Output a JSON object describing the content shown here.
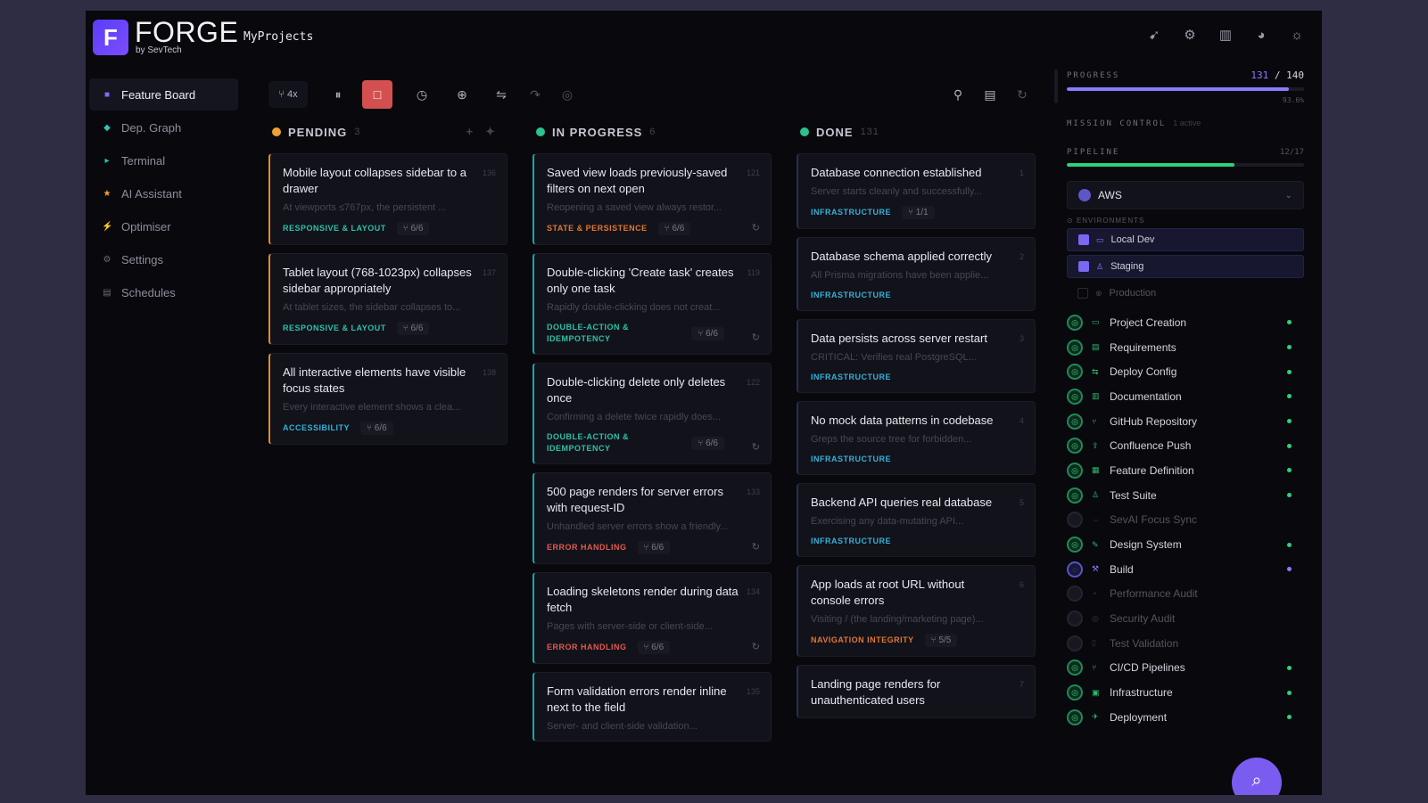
{
  "header": {
    "logo_letter": "F",
    "brand": "FORGE",
    "brand_sub": "by SevTech",
    "project": "MyProjects",
    "icons": [
      "rocket-icon",
      "gear-icon",
      "book-icon",
      "palette-icon",
      "sun-icon"
    ]
  },
  "sidebar": {
    "items": [
      {
        "label": "Feature Board",
        "icon": "■",
        "color": "#7c6cff"
      },
      {
        "label": "Dep. Graph",
        "icon": "◆",
        "color": "#2ec4b6"
      },
      {
        "label": "Terminal",
        "icon": "▸",
        "color": "#2ec4b6"
      },
      {
        "label": "AI Assistant",
        "icon": "★",
        "color": "#f0a030"
      },
      {
        "label": "Optimiser",
        "icon": "⚡",
        "color": "#22a6d8"
      },
      {
        "label": "Settings",
        "icon": "⚙",
        "color": "#6a6a78"
      },
      {
        "label": "Schedules",
        "icon": "▤",
        "color": "#6a6a78"
      }
    ]
  },
  "toolbar": {
    "concurrency": "⑂ 4x",
    "pause": "⏸",
    "stop": "□",
    "clock": "◷",
    "globe": "⊕",
    "sliders": "⇋",
    "dim1": "↷",
    "dim2": "◎",
    "right1": "⚲",
    "right2": "▤",
    "right3": "↻"
  },
  "columns": {
    "pending": {
      "title": "PENDING",
      "count": "3",
      "color": "#f0a030",
      "cards": [
        {
          "title": "Mobile layout collapses sidebar to a drawer",
          "id": "136",
          "desc": "At viewports ≤767px, the persistent ...",
          "tag": "RESPONSIVE & LAYOUT",
          "tag_class": "green",
          "count": "⑂ 6/6"
        },
        {
          "title": "Tablet layout (768-1023px) collapses sidebar appropriately",
          "id": "137",
          "desc": "At tablet sizes, the sidebar collapses to...",
          "tag": "RESPONSIVE & LAYOUT",
          "tag_class": "green",
          "count": "⑂ 6/6"
        },
        {
          "title": "All interactive elements have visible focus states",
          "id": "138",
          "desc": "Every interactive element shows a clea...",
          "tag": "ACCESSIBILITY",
          "tag_class": "blue",
          "count": "⑂ 6/6"
        }
      ]
    },
    "inprogress": {
      "title": "IN PROGRESS",
      "count": "6",
      "color": "#2cc28e",
      "cards": [
        {
          "title": "Saved view loads previously-saved filters on next open",
          "id": "121",
          "desc": "Reopening a saved view always restor...",
          "tag": "STATE & PERSISTENCE",
          "tag_class": "orange",
          "count": "⑂ 6/6"
        },
        {
          "title": "Double-clicking 'Create task' creates only one task",
          "id": "119",
          "desc": "Rapidly double-clicking does not creat...",
          "tag": "DOUBLE-ACTION & IDEMPOTENCY",
          "tag_class": "green",
          "count": "⑂ 6/6"
        },
        {
          "title": "Double-clicking delete only deletes once",
          "id": "122",
          "desc": "Confirming a delete twice rapidly does...",
          "tag": "DOUBLE-ACTION & IDEMPOTENCY",
          "tag_class": "green",
          "count": "⑂ 6/6"
        },
        {
          "title": "500 page renders for server errors with request-ID",
          "id": "133",
          "desc": "Unhandled server errors show a friendly...",
          "tag": "ERROR HANDLING",
          "tag_class": "red",
          "count": "⑂ 6/6"
        },
        {
          "title": "Loading skeletons render during data fetch",
          "id": "134",
          "desc": "Pages with server-side or client-side...",
          "tag": "ERROR HANDLING",
          "tag_class": "red",
          "count": "⑂ 6/6"
        },
        {
          "title": "Form validation errors render inline next to the field",
          "id": "135",
          "desc": "Server- and client-side validation...",
          "tag": "",
          "tag_class": "green",
          "count": ""
        }
      ]
    },
    "done": {
      "title": "DONE",
      "count": "131",
      "color": "#2cc28e",
      "cards": [
        {
          "title": "Database connection established",
          "id": "1",
          "desc": "Server starts cleanly and successfully...",
          "tag": "INFRASTRUCTURE",
          "tag_class": "blue",
          "count": "⑂ 1/1"
        },
        {
          "title": "Database schema applied correctly",
          "id": "2",
          "desc": "All Prisma migrations have been applie...",
          "tag": "INFRASTRUCTURE",
          "tag_class": "blue",
          "count": ""
        },
        {
          "title": "Data persists across server restart",
          "id": "3",
          "desc": "CRITICAL: Verifies real PostgreSQL...",
          "tag": "INFRASTRUCTURE",
          "tag_class": "blue",
          "count": ""
        },
        {
          "title": "No mock data patterns in codebase",
          "id": "4",
          "desc": "Greps the source tree for forbidden...",
          "tag": "INFRASTRUCTURE",
          "tag_class": "blue",
          "count": ""
        },
        {
          "title": "Backend API queries real database",
          "id": "5",
          "desc": "Exercising any data-mutating API...",
          "tag": "INFRASTRUCTURE",
          "tag_class": "blue",
          "count": ""
        },
        {
          "title": "App loads at root URL without console errors",
          "id": "6",
          "desc": "Visiting / (the landing/marketing page)...",
          "tag": "NAVIGATION INTEGRITY",
          "tag_class": "orange",
          "count": "⑂ 5/5"
        },
        {
          "title": "Landing page renders for unauthenticated users",
          "id": "7",
          "desc": "",
          "tag": "",
          "tag_class": "blue",
          "count": ""
        }
      ]
    }
  },
  "right": {
    "progress_label": "PROGRESS",
    "progress_done": "131",
    "progress_sep": " / ",
    "progress_total": "140",
    "progress_fraction": 0.936,
    "progress_pct": "93.6%",
    "mission_label": "MISSION CONTROL",
    "mission_sub": "1 active",
    "pipeline_label": "PIPELINE",
    "pipeline_count": "12/17",
    "pipeline_fraction": 0.706,
    "provider": "AWS",
    "env_label": "ENVIRONMENTS",
    "envs": [
      {
        "label": "Local Dev",
        "on": true,
        "icon": "▭"
      },
      {
        "label": "Staging",
        "on": true,
        "icon": "♙"
      },
      {
        "label": "Production",
        "on": false,
        "icon": "⊕"
      }
    ],
    "steps": [
      {
        "label": "Project Creation",
        "state": "done",
        "icon": "▭"
      },
      {
        "label": "Requirements",
        "state": "done",
        "icon": "▤"
      },
      {
        "label": "Deploy Config",
        "state": "done",
        "icon": "⇆"
      },
      {
        "label": "Documentation",
        "state": "done",
        "icon": "▥"
      },
      {
        "label": "GitHub Repository",
        "state": "done",
        "icon": "⑂"
      },
      {
        "label": "Confluence Push",
        "state": "done",
        "icon": "⇪"
      },
      {
        "label": "Feature Definition",
        "state": "done",
        "icon": "▦"
      },
      {
        "label": "Test Suite",
        "state": "done",
        "icon": "♙"
      },
      {
        "label": "SevAI Focus Sync",
        "state": "dim",
        "icon": "⇔"
      },
      {
        "label": "Design System",
        "state": "done",
        "icon": "✎"
      },
      {
        "label": "Build",
        "state": "active",
        "icon": "⚒"
      },
      {
        "label": "Performance Audit",
        "state": "dim",
        "icon": "◔"
      },
      {
        "label": "Security Audit",
        "state": "dim",
        "icon": "◎"
      },
      {
        "label": "Test Validation",
        "state": "dim",
        "icon": "▯"
      },
      {
        "label": "CI/CD Pipelines",
        "state": "done",
        "icon": "⑂"
      },
      {
        "label": "Infrastructure",
        "state": "done",
        "icon": "▣"
      },
      {
        "label": "Deployment",
        "state": "done",
        "icon": "✈"
      }
    ],
    "colors": {
      "accent": "#7b5cf0",
      "success": "#2fd07a",
      "progress": "#8a7cff"
    }
  }
}
